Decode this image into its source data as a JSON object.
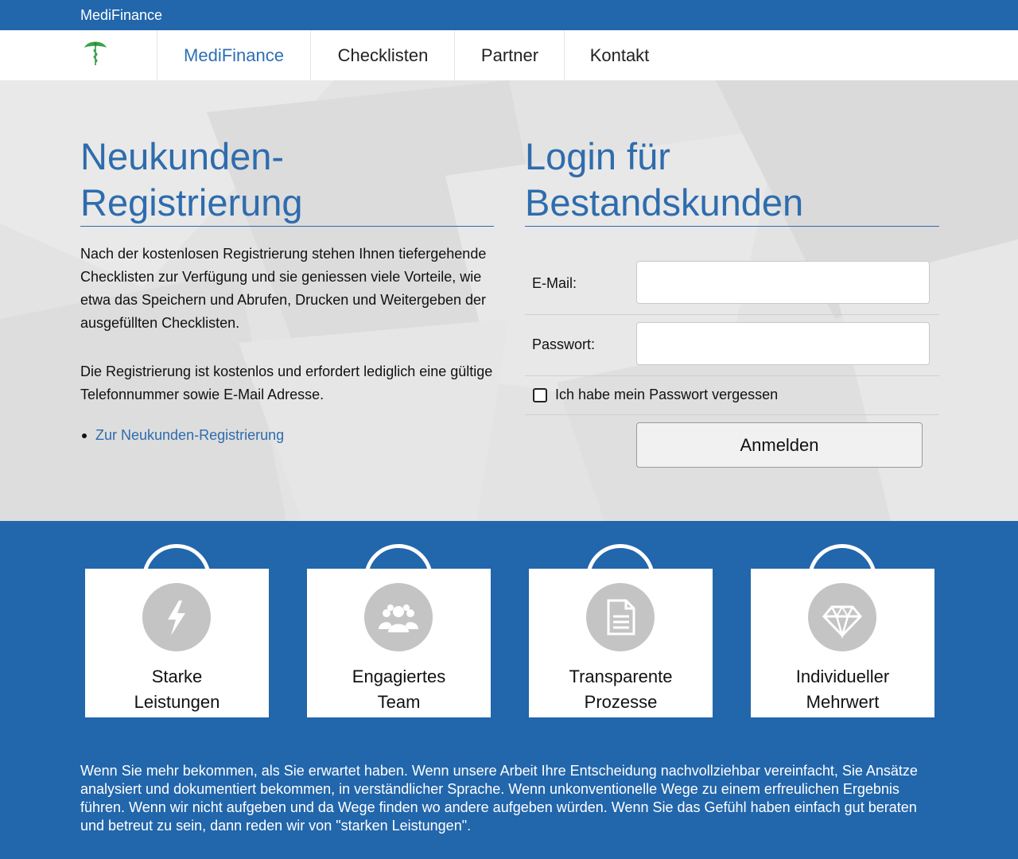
{
  "topbar": {
    "brand": "MediFinance"
  },
  "nav": {
    "items": [
      {
        "label": "MediFinance",
        "active": true
      },
      {
        "label": "Checklisten",
        "active": false
      },
      {
        "label": "Partner",
        "active": false
      },
      {
        "label": "Kontakt",
        "active": false
      }
    ]
  },
  "registration": {
    "title_line1": "Neukunden-",
    "title_line2": "Registrierung",
    "paragraph1": "Nach der kostenlosen Registrierung stehen Ihnen tiefergehende Checklisten zur Verfügung und sie geniessen viele Vorteile, wie etwa das Speichern und Abrufen, Drucken und Weitergeben der ausgefüllten Checklisten.",
    "paragraph2": "Die Registrierung ist kostenlos und erfordert lediglich eine gültige Telefonnummer sowie E-Mail Adresse.",
    "link_label": "Zur Neukunden-Registrierung"
  },
  "login": {
    "title_line1": "Login für",
    "title_line2": "Bestandskunden",
    "email_label": "E-Mail:",
    "email_value": "",
    "password_label": "Passwort:",
    "password_value": "",
    "forgot_label": "Ich habe mein Passwort vergessen",
    "forgot_checked": false,
    "submit_label": "Anmelden"
  },
  "features": [
    {
      "line1": "Starke",
      "line2": "Leistungen",
      "icon": "lightning-icon"
    },
    {
      "line1": "Engagiertes",
      "line2": "Team",
      "icon": "team-icon"
    },
    {
      "line1": "Transparente",
      "line2": "Prozesse",
      "icon": "document-icon"
    },
    {
      "line1": "Individueller",
      "line2": "Mehrwert",
      "icon": "diamond-icon"
    }
  ],
  "footer": {
    "text": "Wenn Sie mehr bekommen, als Sie erwartet haben. Wenn unsere Arbeit Ihre Entscheidung nachvollziehbar vereinfacht, Sie Ansätze analysiert und dokumentiert bekommen, in verständlicher Sprache. Wenn unkonventionelle Wege zu einem erfreulichen Ergebnis führen. Wenn wir nicht aufgeben und da Wege finden wo andere aufgeben würden. Wenn Sie das Gefühl haben einfach gut beraten und betreut zu sein, dann reden wir von \"starken Leistungen\"."
  },
  "colors": {
    "brand_blue": "#2266ab",
    "heading_blue": "#2e6cad",
    "hero_bg": "#e3e3e3",
    "icon_circle": "#c4c4c4"
  }
}
